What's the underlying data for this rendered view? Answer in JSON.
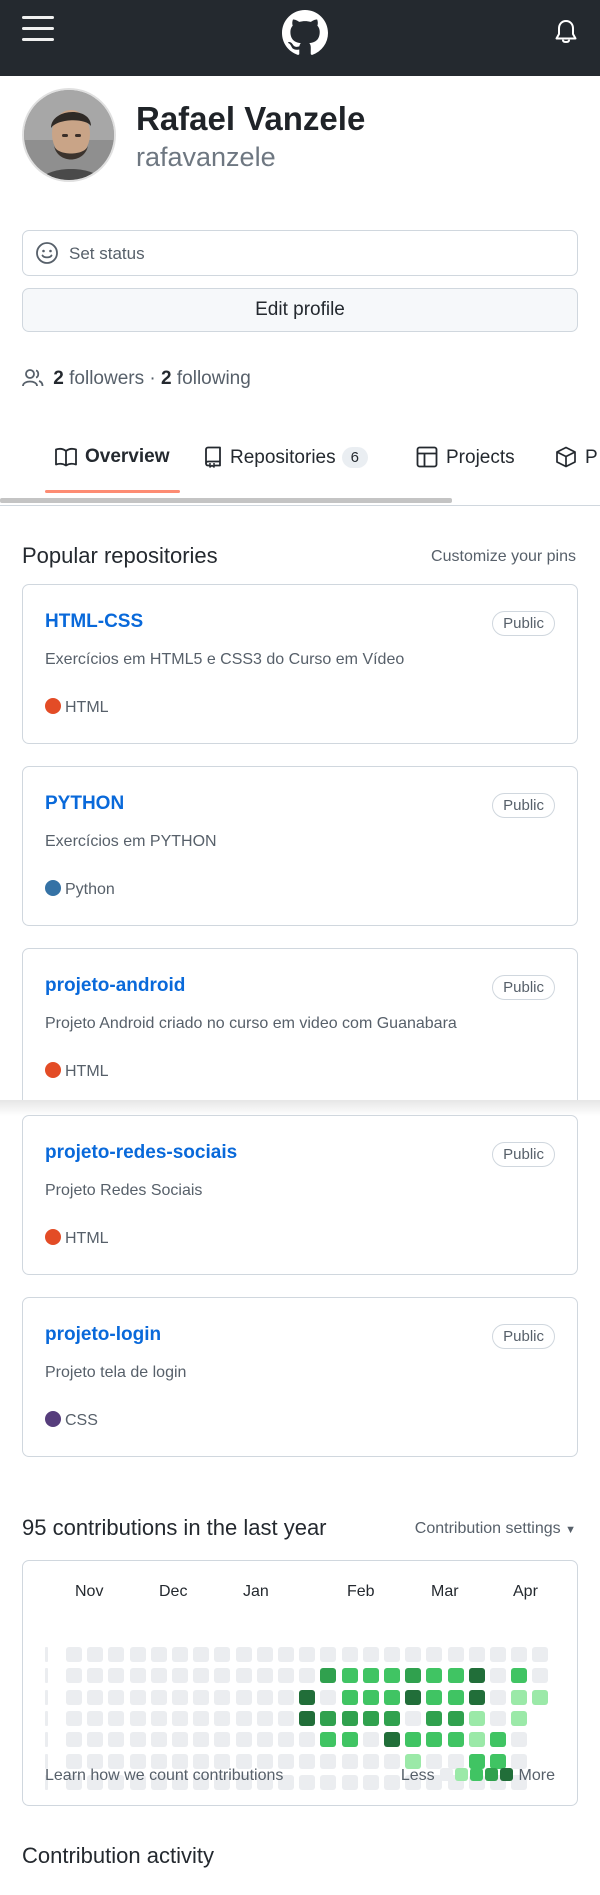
{
  "header": {
    "menu_icon": "hamburger-icon",
    "logo_icon": "github-mark-icon",
    "bell_icon": "bell-icon"
  },
  "profile": {
    "name": "Rafael Vanzele",
    "username": "rafavanzele",
    "status_placeholder": "Set status",
    "edit_button": "Edit profile",
    "followers_count": "2",
    "followers_label": "followers",
    "separator": "·",
    "following_count": "2",
    "following_label": "following"
  },
  "tabs": [
    {
      "label": "Overview",
      "icon": "book-icon",
      "selected": true
    },
    {
      "label": "Repositories",
      "icon": "repo-icon",
      "count": "6"
    },
    {
      "label": "Projects",
      "icon": "table-icon"
    },
    {
      "label": "P",
      "icon": "package-icon"
    }
  ],
  "popular": {
    "title": "Popular repositories",
    "customize": "Customize your pins",
    "repos": [
      {
        "name": "HTML-CSS",
        "visibility": "Public",
        "description": "Exercícios em HTML5 e CSS3 do Curso em Vídeo",
        "language": "HTML",
        "lang_color": "#e34c26"
      },
      {
        "name": "PYTHON",
        "visibility": "Public",
        "description": "Exercícios em PYTHON",
        "language": "Python",
        "lang_color": "#3572a5"
      },
      {
        "name": "projeto-android",
        "visibility": "Public",
        "description": "Projeto Android criado no curso em video com Guanabara",
        "language": "HTML",
        "lang_color": "#e34c26"
      },
      {
        "name": "projeto-redes-sociais",
        "visibility": "Public",
        "description": "Projeto Redes Sociais",
        "language": "HTML",
        "lang_color": "#e34c26"
      },
      {
        "name": "projeto-login",
        "visibility": "Public",
        "description": "Projeto tela de login",
        "language": "CSS",
        "lang_color": "#563d7c"
      }
    ]
  },
  "contributions": {
    "title": "95 contributions in the last year",
    "settings": "Contribution settings",
    "months": [
      "Nov",
      "Dec",
      "Jan",
      "Feb",
      "Mar",
      "Apr"
    ],
    "learn": "Learn how we count contributions",
    "less": "Less",
    "more": "More",
    "colors": [
      "#ebedf0",
      "#9be9a8",
      "#40c463",
      "#30a14e",
      "#216e39"
    ],
    "levels": [
      "00000000000000000000000",
      "00000000000032223224020",
      "00000000000402224224011",
      "00000000000433330331010",
      "00000000000022042221200",
      "00000000000000001002200",
      "00000000000000000000000"
    ]
  },
  "activity": {
    "title": "Contribution activity"
  }
}
